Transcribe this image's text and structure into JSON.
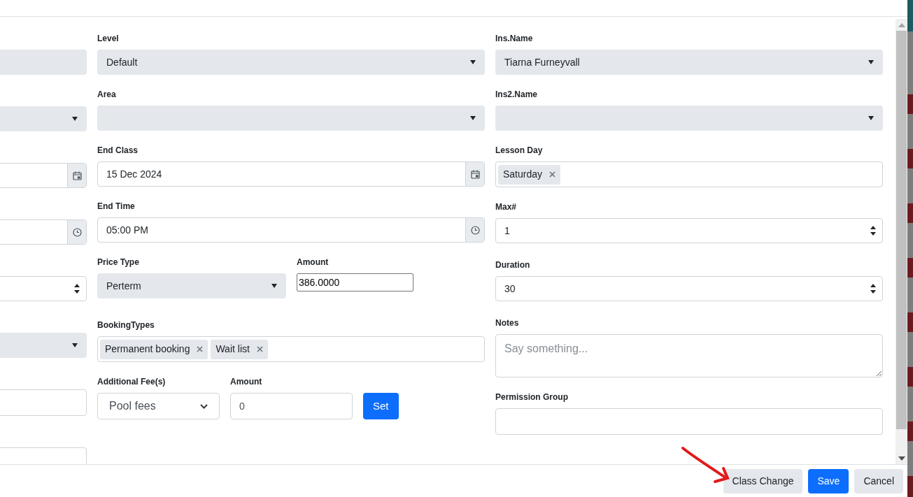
{
  "left_fields": [
    {
      "kind": "disabled"
    },
    {
      "kind": "select"
    },
    {
      "kind": "date"
    },
    {
      "kind": "time"
    },
    {
      "kind": "number"
    },
    {
      "kind": "select"
    },
    {
      "kind": "text"
    },
    {
      "kind": "text"
    }
  ],
  "middle_rows": [
    [
      {
        "label": "Level",
        "kind": "select",
        "value": "Default"
      }
    ],
    [
      {
        "label": "Area",
        "kind": "select"
      }
    ],
    [
      {
        "label": "End Class",
        "kind": "date",
        "value": "15 Dec 2024"
      }
    ],
    [
      {
        "label": "End Time",
        "kind": "time",
        "value": "05:00 PM"
      }
    ],
    [
      {
        "label": "Price Type",
        "kind": "select",
        "value": "Perterm"
      },
      {
        "label": "Amount",
        "kind": "plain",
        "value": "386.0000"
      }
    ],
    [
      {
        "label": "BookingTypes",
        "kind": "tags",
        "tags": [
          "Permanent booking",
          "Wait list"
        ]
      }
    ],
    [
      {
        "label": "Additional Fee(s)",
        "kind": "native-select",
        "value": "Pool fees"
      },
      {
        "label": "Amount",
        "kind": "text",
        "value": "0"
      },
      {
        "kind": "button",
        "text": "Set"
      }
    ]
  ],
  "right_fields": [
    {
      "label": "Ins.Name",
      "kind": "select",
      "value": "Tiarna Furneyvall"
    },
    {
      "label": "Ins2.Name",
      "kind": "select"
    },
    {
      "label": "Lesson Day",
      "kind": "tags",
      "tags": [
        "Saturday"
      ]
    },
    {
      "label": "Max#",
      "kind": "number",
      "value": "1"
    },
    {
      "label": "Duration",
      "kind": "number",
      "value": "30"
    },
    {
      "label": "Notes",
      "kind": "textarea",
      "placeholder": "Say something..."
    },
    {
      "label": "Permission Group",
      "kind": "text"
    }
  ],
  "footer_buttons": [
    {
      "text": "Class Change",
      "kind": "secondary"
    },
    {
      "text": "Save",
      "kind": "primary"
    },
    {
      "text": "Cancel",
      "kind": "secondary"
    }
  ]
}
